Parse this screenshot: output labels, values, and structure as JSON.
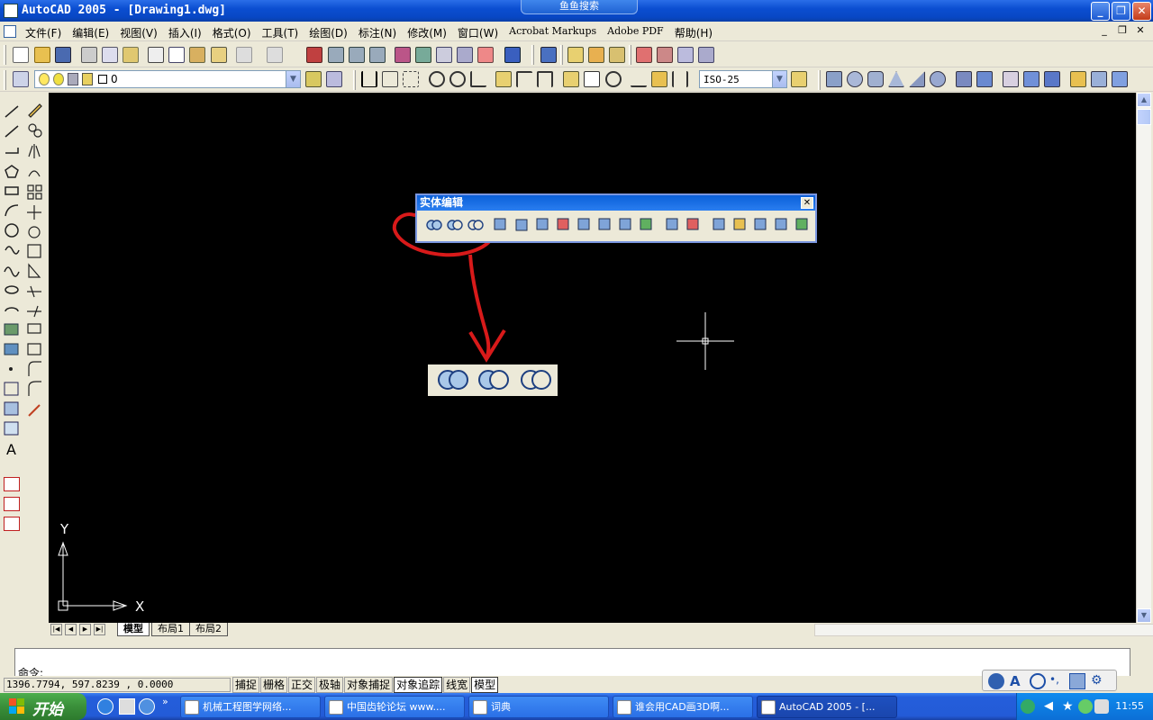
{
  "window": {
    "title": "AutoCAD 2005 - [Drawing1.dwg]",
    "search_tab": "鱼鱼搜索",
    "minimize": "_",
    "restore": "❐",
    "close": "✕"
  },
  "menu": {
    "items": [
      "文件(F)",
      "编辑(E)",
      "视图(V)",
      "插入(I)",
      "格式(O)",
      "工具(T)",
      "绘图(D)",
      "标注(N)",
      "修改(M)",
      "窗口(W)",
      "Acrobat Markups",
      "Adobe PDF",
      "帮助(H)"
    ],
    "mdi_min": "_",
    "mdi_restore": "❐",
    "mdi_close": "✕"
  },
  "toolbar": {
    "layer_value": "0",
    "dim_style": "ISO-25"
  },
  "floating_toolbar": {
    "title": "实体编辑",
    "close": "✕"
  },
  "ucs": {
    "y_label": "Y",
    "x_label": "X"
  },
  "layout_tabs": [
    "模型",
    "布局1",
    "布局2"
  ],
  "command": {
    "prompt": "命令:"
  },
  "status": {
    "coords": "1396.7794, 597.8239 , 0.0000",
    "modes": [
      {
        "label": "捕捉",
        "on": false
      },
      {
        "label": "栅格",
        "on": false
      },
      {
        "label": "正交",
        "on": false
      },
      {
        "label": "极轴",
        "on": false
      },
      {
        "label": "对象捕捉",
        "on": false
      },
      {
        "label": "对象追踪",
        "on": true
      },
      {
        "label": "线宽",
        "on": false
      },
      {
        "label": "模型",
        "on": true
      }
    ]
  },
  "taskbar": {
    "start": "开始",
    "tasks": [
      "机械工程图学网络...",
      "中国齿轮论坛 www....",
      "词典",
      "谁会用CAD画3D啊...",
      "AutoCAD 2005 - [..."
    ],
    "clock": "11:55"
  },
  "colors": {
    "canvas": "#000000",
    "annotation": "#d81a1a",
    "titlebar": "#0b4ed1"
  }
}
